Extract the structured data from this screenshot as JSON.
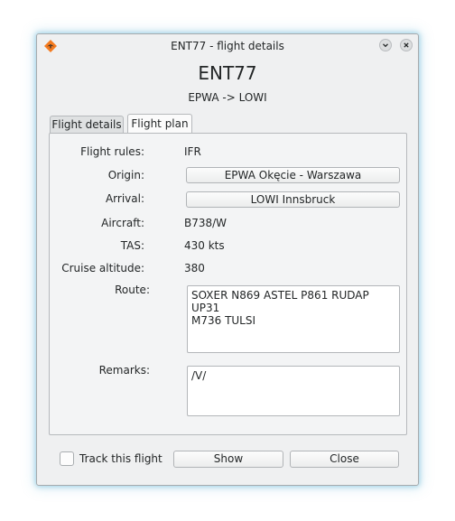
{
  "window": {
    "title": "ENT77 - flight details",
    "icons": {
      "app": "aircraft-app-icon",
      "minimize": "chevron-down-icon",
      "close": "close-icon"
    },
    "accent_glow": "#78bedc"
  },
  "header": {
    "callsign": "ENT77",
    "route": "EPWA -> LOWI"
  },
  "tabs": [
    {
      "label": "Flight details",
      "active": false
    },
    {
      "label": "Flight plan",
      "active": true
    }
  ],
  "plan": {
    "flight_rules": {
      "label": "Flight rules:",
      "value": "IFR"
    },
    "origin": {
      "label": "Origin:",
      "value": "EPWA Okęcie - Warszawa"
    },
    "arrival": {
      "label": "Arrival:",
      "value": "LOWI Innsbruck"
    },
    "aircraft": {
      "label": "Aircraft:",
      "value": "B738/W"
    },
    "tas": {
      "label": "TAS:",
      "value": "430 kts"
    },
    "cruise_altitude": {
      "label": "Cruise altitude:",
      "value": "380"
    },
    "route": {
      "label": "Route:",
      "value": "SOXER N869 ASTEL P861 RUDAP UP31\nM736 TULSI"
    },
    "remarks": {
      "label": "Remarks:",
      "value": "/V/"
    }
  },
  "footer": {
    "track_label": "Track this flight",
    "track_checked": false,
    "show_label": "Show",
    "close_label": "Close"
  }
}
